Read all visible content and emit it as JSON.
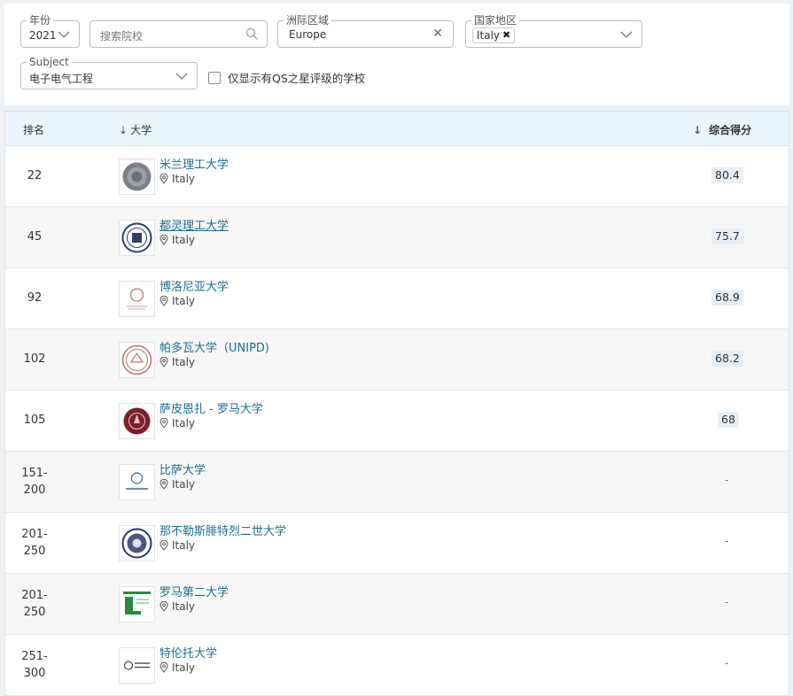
{
  "filters": {
    "year": {
      "label": "年份",
      "value": "2021"
    },
    "search": {
      "placeholder": "搜索院校"
    },
    "region": {
      "label": "洲际区域",
      "value": "Europe",
      "clear_icon": "close-icon"
    },
    "country": {
      "label": "国家地区",
      "chip": "Italy",
      "chip_remove": "✖"
    },
    "subject": {
      "label": "Subject",
      "value": "电子电气工程"
    },
    "qs_stars": {
      "label": "仅显示有QS之星评级的学校",
      "checked": false
    }
  },
  "table": {
    "headers": {
      "rank": "排名",
      "university": "大学",
      "score": "综合得分"
    },
    "rows": [
      {
        "rank": "22",
        "name": "米兰理工大学",
        "location": "Italy",
        "score": "80.4"
      },
      {
        "rank": "45",
        "name": "都灵理工大学",
        "location": "Italy",
        "score": "75.7"
      },
      {
        "rank": "92",
        "name": "博洛尼亚大学",
        "location": "Italy",
        "score": "68.9"
      },
      {
        "rank": "102",
        "name": "帕多瓦大学（UNIPD)",
        "location": "Italy",
        "score": "68.2"
      },
      {
        "rank": "105",
        "name": "萨皮恩扎 - 罗马大学",
        "location": "Italy",
        "score": "68"
      },
      {
        "rank_line1": "151-",
        "rank_line2": "200",
        "name": "比萨大学",
        "location": "Italy",
        "score": "-"
      },
      {
        "rank_line1": "201-",
        "rank_line2": "250",
        "name": "那不勒斯腓特烈二世大学",
        "location": "Italy",
        "score": "-"
      },
      {
        "rank_line1": "201-",
        "rank_line2": "250",
        "name": "罗马第二大学",
        "location": "Italy",
        "score": "-"
      },
      {
        "rank_line1": "251-",
        "rank_line2": "300",
        "name": "特伦托大学",
        "location": "Italy",
        "score": "-"
      }
    ]
  },
  "colors": {
    "link": "#1a6f8f",
    "header_bg": "#eaf6fd",
    "alt_row": "#f7f7f7",
    "score_bg": "#e7eef5"
  }
}
